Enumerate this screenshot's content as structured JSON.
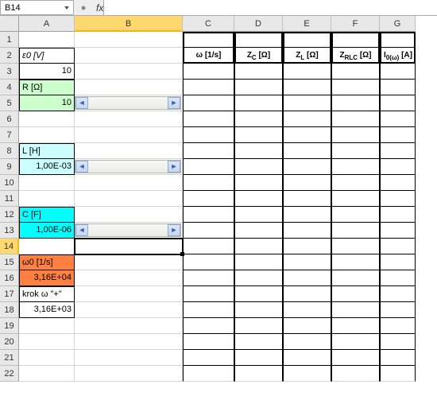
{
  "namebox": "B14",
  "fx_label": "fx",
  "columns": [
    "A",
    "B",
    "C",
    "D",
    "E",
    "F",
    "G"
  ],
  "rows": [
    "1",
    "2",
    "3",
    "4",
    "5",
    "6",
    "7",
    "8",
    "9",
    "10",
    "11",
    "12",
    "13",
    "14",
    "15",
    "16",
    "17",
    "18",
    "19",
    "20",
    "21",
    "22"
  ],
  "params": {
    "e0_label": "ε0 [V]",
    "e0_value": "10",
    "R_label": "R [Ω]",
    "R_value": "10",
    "L_label": "L [H]",
    "L_value": "1,00E-03",
    "C_label": "C [F]",
    "C_value": "1,00E-06",
    "w0_label": "ω0 [1/s]",
    "w0_value": "3,16E+04",
    "krok_label": "krok ω \"+\"",
    "krok_value": "3,16E+03"
  },
  "table_headers": {
    "c": "ω [1/s]",
    "d": "Zc [Ω]",
    "e": "ZL [Ω]",
    "f": "ZRLC [Ω]",
    "g": "I0(ω) [A]"
  },
  "chart_data": {
    "type": "table",
    "title": "RLC circuit parameters and empty impedance/current table",
    "parameters": [
      {
        "name": "ε0",
        "unit": "V",
        "value": 10
      },
      {
        "name": "R",
        "unit": "Ω",
        "value": 10
      },
      {
        "name": "L",
        "unit": "H",
        "value": 0.001
      },
      {
        "name": "C",
        "unit": "F",
        "value": 1e-06
      },
      {
        "name": "ω0",
        "unit": "1/s",
        "value": 31600.0
      },
      {
        "name": "krok ω +",
        "unit": "1/s",
        "value": 3160.0
      }
    ],
    "columns": [
      "ω [1/s]",
      "Zc [Ω]",
      "ZL [Ω]",
      "ZRLC [Ω]",
      "I0(ω) [A]"
    ],
    "rows": []
  }
}
